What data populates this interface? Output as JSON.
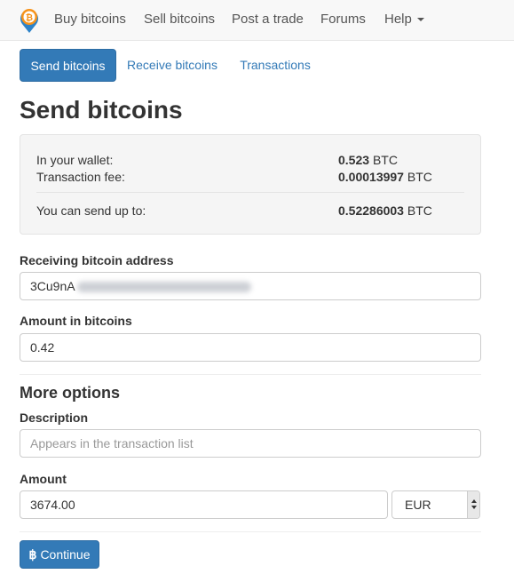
{
  "brand": {
    "logo_icon": "bitcoin-location-pin-icon",
    "accent": "#f7931a",
    "logo_blue": "#2e83c9"
  },
  "nav": {
    "items": [
      {
        "label": "Buy bitcoins"
      },
      {
        "label": "Sell bitcoins"
      },
      {
        "label": "Post a trade"
      },
      {
        "label": "Forums"
      },
      {
        "label": "Help"
      }
    ],
    "help_icon": "caret-down-icon"
  },
  "tabs": [
    {
      "label": "Send bitcoins",
      "active": true
    },
    {
      "label": "Receive bitcoins",
      "active": false
    },
    {
      "label": "Transactions",
      "active": false
    }
  ],
  "page": {
    "title": "Send bitcoins"
  },
  "wallet": {
    "in_wallet_label": "In your wallet:",
    "in_wallet_amount": "0.523",
    "in_wallet_unit": "BTC",
    "fee_label": "Transaction fee:",
    "fee_amount": "0.00013997",
    "fee_unit": "BTC",
    "max_label": "You can send up to:",
    "max_amount": "0.52286003",
    "max_unit": "BTC"
  },
  "form": {
    "address_label": "Receiving bitcoin address",
    "address_visible_prefix": "3Cu9nA",
    "amount_btc_label": "Amount in bitcoins",
    "amount_btc_value": "0.42",
    "more_options_title": "More options",
    "description_label": "Description",
    "description_placeholder": "Appears in the transaction list",
    "amount_label": "Amount",
    "amount_value": "3674.00",
    "currency": "EUR",
    "continue_icon": "bitcoin-icon",
    "continue_icon_glyph": "฿",
    "continue_label": "Continue"
  },
  "colors": {
    "primary": "#337ab7",
    "panel_bg": "#f5f5f5",
    "navbar_bg": "#f8f8f8"
  }
}
